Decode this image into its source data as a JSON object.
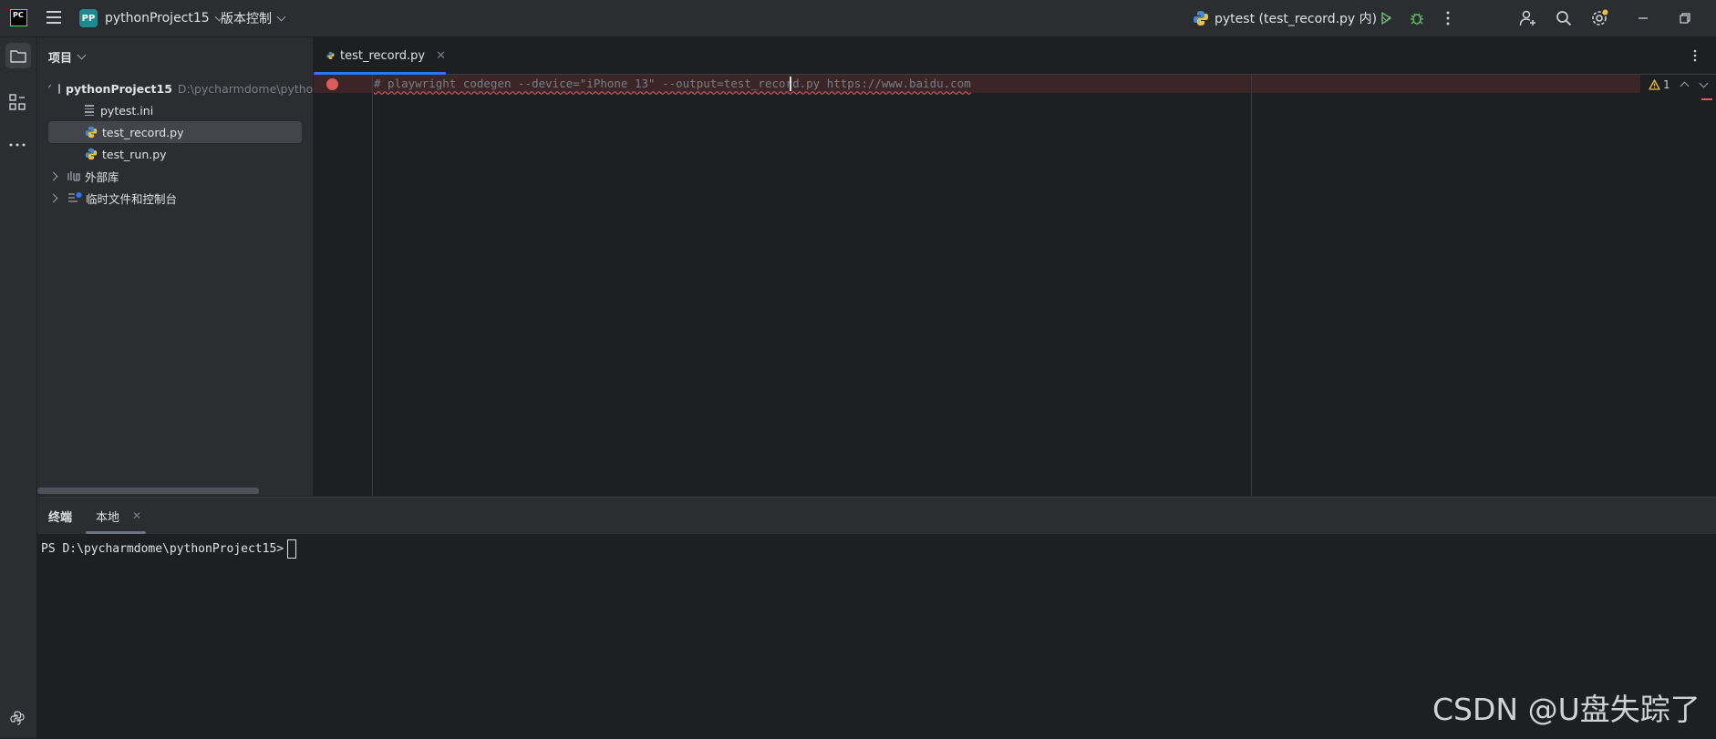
{
  "titlebar": {
    "app_logo": "PC",
    "project_badge": "PP",
    "project_name": "pythonProject15",
    "vcs_label": "版本控制",
    "run_config": "pytest (test_record.py 内)",
    "icons": [
      "main-menu-icon",
      "python-icon",
      "run-icon",
      "debug-icon",
      "more-vertical-icon",
      "add-user-icon",
      "search-icon",
      "settings-icon",
      "minimize-icon",
      "restore-icon"
    ]
  },
  "left_toolbar": {
    "icons": [
      "project-folder-icon",
      "structure-icon",
      "more-horizontal-icon",
      "python-console-icon"
    ]
  },
  "project_panel": {
    "title": "项目",
    "root": {
      "name": "pythonProject15",
      "path": "D:\\pycharmdome\\pythor"
    },
    "files": [
      {
        "name": "pytest.ini",
        "icon": "ini-file-icon"
      },
      {
        "name": "test_record.py",
        "icon": "python-file-icon",
        "selected": true
      },
      {
        "name": "test_run.py",
        "icon": "python-file-icon"
      }
    ],
    "external_libs": "外部库",
    "scratches": "临时文件和控制台"
  },
  "editor": {
    "tab_name": "test_record.py",
    "code_line": "# playwright codegen --device=\"iPhone 13\" --output=test_record.py https://www.baidu.com",
    "warning_count": "1"
  },
  "terminal": {
    "tab_title": "终端",
    "session_tab": "本地",
    "prompt": "PS D:\\pycharmdome\\pythonProject15>"
  },
  "watermark": "CSDN @U盘失踪了",
  "colors": {
    "accent": "#3574f0",
    "breakpoint": "#db5c5c",
    "error_line_bg": "#3b2527",
    "run_green": "#5fb865"
  }
}
